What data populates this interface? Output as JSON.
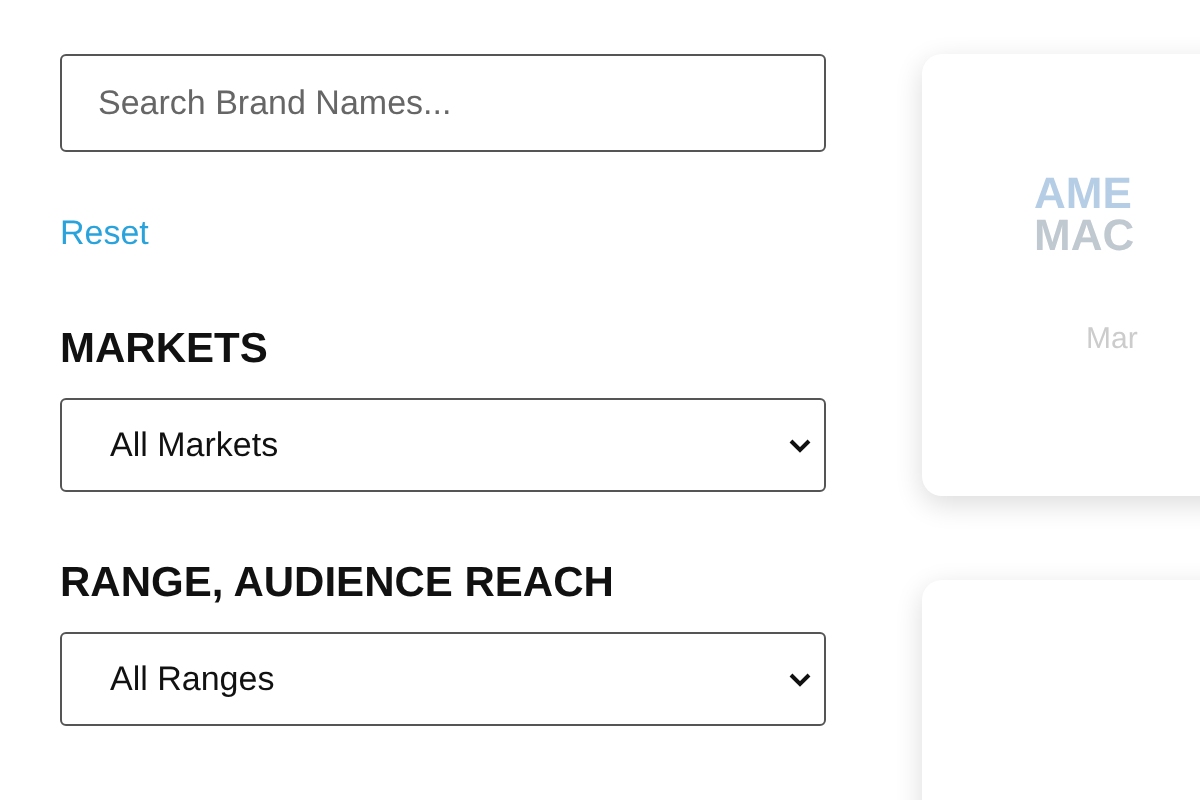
{
  "search": {
    "placeholder": "Search Brand Names..."
  },
  "reset": "Reset",
  "filters": [
    {
      "heading": "MARKETS",
      "value": "All Markets"
    },
    {
      "heading": "RANGE, AUDIENCE REACH",
      "value": "All Ranges"
    }
  ],
  "cards": [
    {
      "kind": "logo",
      "logo_lines": [
        "AME",
        "MAC"
      ],
      "caption": "Mar"
    },
    {
      "kind": "blank"
    }
  ]
}
